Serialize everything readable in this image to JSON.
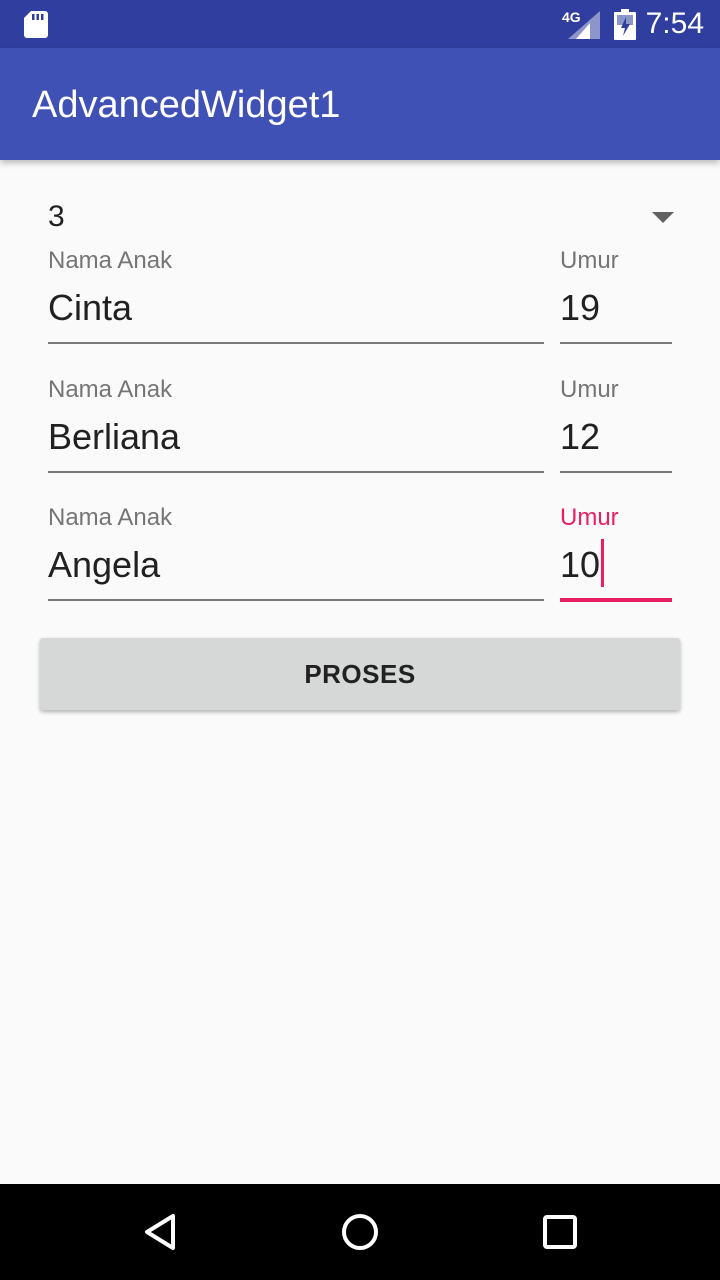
{
  "status_bar": {
    "network": "4G",
    "time": "7:54",
    "icons": [
      "sd-card-icon",
      "signal-icon",
      "battery-icon"
    ]
  },
  "app_bar": {
    "title": "AdvancedWidget1"
  },
  "spinner": {
    "selected": "3"
  },
  "rows": [
    {
      "name_label": "Nama Anak",
      "name_value": "Cinta",
      "age_label": "Umur",
      "age_value": "19"
    },
    {
      "name_label": "Nama Anak",
      "name_value": "Berliana",
      "age_label": "Umur",
      "age_value": "12"
    },
    {
      "name_label": "Nama Anak",
      "name_value": "Angela",
      "age_label": "Umur",
      "age_value": "10"
    }
  ],
  "button": {
    "label": "PROSES"
  },
  "nav_bar": {
    "icons": [
      "back-icon",
      "home-icon",
      "recent-apps-icon"
    ]
  },
  "colors": {
    "status_bar": "#303f9f",
    "app_bar": "#3f51b5",
    "accent": "#e91e63",
    "button": "#d6d7d7"
  }
}
